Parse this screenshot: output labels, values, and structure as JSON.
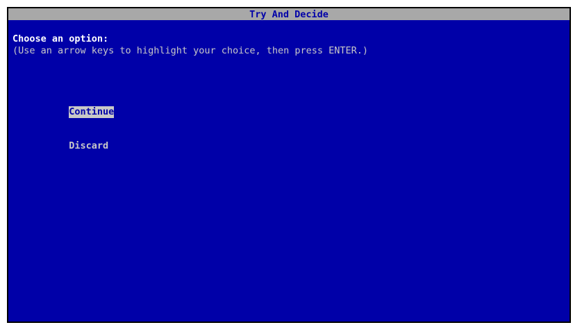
{
  "window": {
    "title": "Try And Decide"
  },
  "prompt": {
    "heading": "Choose an option:",
    "instructions": "(Use an arrow keys to highlight your choice, then press ENTER.)"
  },
  "menu": {
    "items": [
      {
        "label": "Continue",
        "selected": true
      },
      {
        "label": "Discard",
        "selected": false
      }
    ]
  },
  "colors": {
    "background": "#0000a8",
    "title_bar": "#a8a8a8",
    "text": "#ffffff",
    "highlight": "#c8c8c8"
  }
}
